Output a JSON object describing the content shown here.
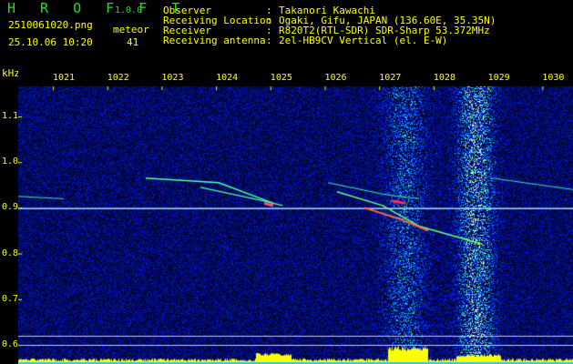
{
  "header": {
    "app_name": "H R O F F T",
    "version": "1.0.0",
    "filename": "2510061020.png",
    "datetime": "25.10.06 10:20",
    "meteor_label": "meteor",
    "meteor_count": "41",
    "info": [
      {
        "label": "Observer",
        "value": "Takanori Kawachi"
      },
      {
        "label": "Receiving Location",
        "value": "Ogaki, Gifu, JAPAN (136.60E, 35.35N)"
      },
      {
        "label": "Receiver",
        "value": "R820T2(RTL-SDR) SDR-Sharp 53.372MHz"
      },
      {
        "label": "Receiving antenna",
        "value": "2el-HB9CV Vertical (el. E-W)"
      }
    ]
  },
  "chart_data": {
    "type": "heatmap",
    "title": "Spectrogram",
    "ylabel": "kHz",
    "x_ticks": [
      "1021",
      "1022",
      "1023",
      "1024",
      "1025",
      "1026",
      "1027",
      "1028",
      "1029",
      "1030"
    ],
    "y_ticks": [
      "1.1",
      "1.0",
      "0.9",
      "0.8",
      "0.7",
      "0.6"
    ],
    "ylim": [
      0.58,
      1.17
    ],
    "carrier_khz": 0.9,
    "colors": {
      "noise": "#0a1a9a",
      "band": "#22aaff",
      "text": "#ffff00",
      "level": "#ffff00"
    }
  }
}
